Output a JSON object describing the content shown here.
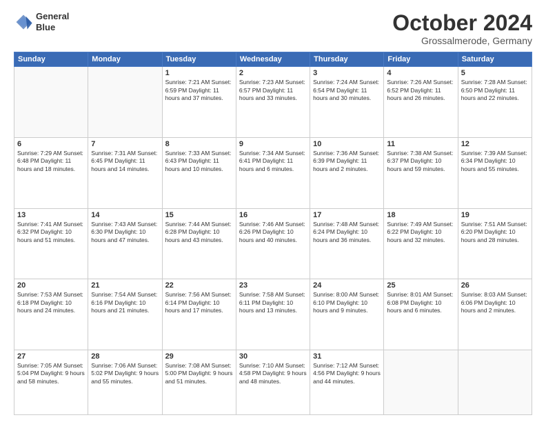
{
  "header": {
    "logo_line1": "General",
    "logo_line2": "Blue",
    "month": "October 2024",
    "location": "Grossalmerode, Germany"
  },
  "weekdays": [
    "Sunday",
    "Monday",
    "Tuesday",
    "Wednesday",
    "Thursday",
    "Friday",
    "Saturday"
  ],
  "weeks": [
    [
      {
        "day": "",
        "info": ""
      },
      {
        "day": "",
        "info": ""
      },
      {
        "day": "1",
        "info": "Sunrise: 7:21 AM\nSunset: 6:59 PM\nDaylight: 11 hours\nand 37 minutes."
      },
      {
        "day": "2",
        "info": "Sunrise: 7:23 AM\nSunset: 6:57 PM\nDaylight: 11 hours\nand 33 minutes."
      },
      {
        "day": "3",
        "info": "Sunrise: 7:24 AM\nSunset: 6:54 PM\nDaylight: 11 hours\nand 30 minutes."
      },
      {
        "day": "4",
        "info": "Sunrise: 7:26 AM\nSunset: 6:52 PM\nDaylight: 11 hours\nand 26 minutes."
      },
      {
        "day": "5",
        "info": "Sunrise: 7:28 AM\nSunset: 6:50 PM\nDaylight: 11 hours\nand 22 minutes."
      }
    ],
    [
      {
        "day": "6",
        "info": "Sunrise: 7:29 AM\nSunset: 6:48 PM\nDaylight: 11 hours\nand 18 minutes."
      },
      {
        "day": "7",
        "info": "Sunrise: 7:31 AM\nSunset: 6:45 PM\nDaylight: 11 hours\nand 14 minutes."
      },
      {
        "day": "8",
        "info": "Sunrise: 7:33 AM\nSunset: 6:43 PM\nDaylight: 11 hours\nand 10 minutes."
      },
      {
        "day": "9",
        "info": "Sunrise: 7:34 AM\nSunset: 6:41 PM\nDaylight: 11 hours\nand 6 minutes."
      },
      {
        "day": "10",
        "info": "Sunrise: 7:36 AM\nSunset: 6:39 PM\nDaylight: 11 hours\nand 2 minutes."
      },
      {
        "day": "11",
        "info": "Sunrise: 7:38 AM\nSunset: 6:37 PM\nDaylight: 10 hours\nand 59 minutes."
      },
      {
        "day": "12",
        "info": "Sunrise: 7:39 AM\nSunset: 6:34 PM\nDaylight: 10 hours\nand 55 minutes."
      }
    ],
    [
      {
        "day": "13",
        "info": "Sunrise: 7:41 AM\nSunset: 6:32 PM\nDaylight: 10 hours\nand 51 minutes."
      },
      {
        "day": "14",
        "info": "Sunrise: 7:43 AM\nSunset: 6:30 PM\nDaylight: 10 hours\nand 47 minutes."
      },
      {
        "day": "15",
        "info": "Sunrise: 7:44 AM\nSunset: 6:28 PM\nDaylight: 10 hours\nand 43 minutes."
      },
      {
        "day": "16",
        "info": "Sunrise: 7:46 AM\nSunset: 6:26 PM\nDaylight: 10 hours\nand 40 minutes."
      },
      {
        "day": "17",
        "info": "Sunrise: 7:48 AM\nSunset: 6:24 PM\nDaylight: 10 hours\nand 36 minutes."
      },
      {
        "day": "18",
        "info": "Sunrise: 7:49 AM\nSunset: 6:22 PM\nDaylight: 10 hours\nand 32 minutes."
      },
      {
        "day": "19",
        "info": "Sunrise: 7:51 AM\nSunset: 6:20 PM\nDaylight: 10 hours\nand 28 minutes."
      }
    ],
    [
      {
        "day": "20",
        "info": "Sunrise: 7:53 AM\nSunset: 6:18 PM\nDaylight: 10 hours\nand 24 minutes."
      },
      {
        "day": "21",
        "info": "Sunrise: 7:54 AM\nSunset: 6:16 PM\nDaylight: 10 hours\nand 21 minutes."
      },
      {
        "day": "22",
        "info": "Sunrise: 7:56 AM\nSunset: 6:14 PM\nDaylight: 10 hours\nand 17 minutes."
      },
      {
        "day": "23",
        "info": "Sunrise: 7:58 AM\nSunset: 6:11 PM\nDaylight: 10 hours\nand 13 minutes."
      },
      {
        "day": "24",
        "info": "Sunrise: 8:00 AM\nSunset: 6:10 PM\nDaylight: 10 hours\nand 9 minutes."
      },
      {
        "day": "25",
        "info": "Sunrise: 8:01 AM\nSunset: 6:08 PM\nDaylight: 10 hours\nand 6 minutes."
      },
      {
        "day": "26",
        "info": "Sunrise: 8:03 AM\nSunset: 6:06 PM\nDaylight: 10 hours\nand 2 minutes."
      }
    ],
    [
      {
        "day": "27",
        "info": "Sunrise: 7:05 AM\nSunset: 5:04 PM\nDaylight: 9 hours\nand 58 minutes."
      },
      {
        "day": "28",
        "info": "Sunrise: 7:06 AM\nSunset: 5:02 PM\nDaylight: 9 hours\nand 55 minutes."
      },
      {
        "day": "29",
        "info": "Sunrise: 7:08 AM\nSunset: 5:00 PM\nDaylight: 9 hours\nand 51 minutes."
      },
      {
        "day": "30",
        "info": "Sunrise: 7:10 AM\nSunset: 4:58 PM\nDaylight: 9 hours\nand 48 minutes."
      },
      {
        "day": "31",
        "info": "Sunrise: 7:12 AM\nSunset: 4:56 PM\nDaylight: 9 hours\nand 44 minutes."
      },
      {
        "day": "",
        "info": ""
      },
      {
        "day": "",
        "info": ""
      }
    ]
  ]
}
